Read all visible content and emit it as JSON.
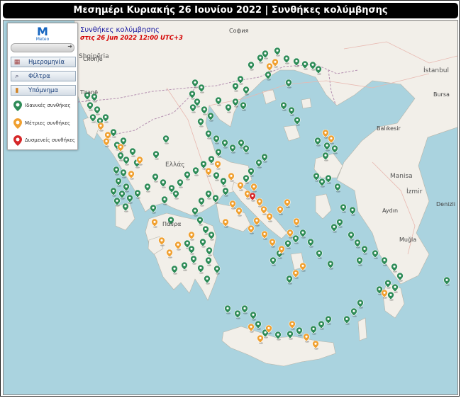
{
  "header": {
    "title": "Μεσημέρι Κυριακής 26 Ιουνίου 2022 | Συνθήκες κολύμβησης"
  },
  "map_title": {
    "title": "Συνθήκες κολύμβησης",
    "subtitle": "στις 26 Jun 2022 12:00 UTC+3"
  },
  "legend": {
    "logo_text": "Meteo",
    "buttons": [
      {
        "label": "Ημερομηνία",
        "icon": "calendar-icon"
      },
      {
        "label": "Φίλτρα",
        "icon": "filter-icon"
      },
      {
        "label": "Υπόμνημα",
        "icon": "legend-icon"
      }
    ],
    "items": [
      {
        "label": "Ιδανικές συνθήκες",
        "color": "#2e8b57"
      },
      {
        "label": "Μέτριες συνθήκες",
        "color": "#f0a030"
      },
      {
        "label": "Δυσμενείς συνθήκες",
        "color": "#d62728"
      }
    ]
  },
  "colors": {
    "ideal": "#2e8b57",
    "moderate": "#f0a030",
    "adverse": "#d62728",
    "sea": "#aad3df",
    "land": "#f2efe9"
  },
  "places": {
    "skopje": "Скопје",
    "sofia": "София",
    "istanbul": "İstanbul",
    "tirane": "Tiranë",
    "shqiperia": "Shqipëria",
    "ellas": "Ελλάς",
    "patra": "Πάτρα",
    "izmir": "İzmir",
    "balikesir": "Balıkesir",
    "manisa": "Manisa",
    "aydin": "Aydın",
    "mugla": "Muğla",
    "bursa": "Bursa",
    "denizli": "Denizli"
  },
  "markers": {
    "ideal": [
      [
        121,
        139
      ],
      [
        131,
        141
      ],
      [
        125,
        153
      ],
      [
        135,
        159
      ],
      [
        129,
        170
      ],
      [
        139,
        175
      ],
      [
        147,
        170
      ],
      [
        158,
        191
      ],
      [
        163,
        209
      ],
      [
        172,
        203
      ],
      [
        168,
        224
      ],
      [
        176,
        230
      ],
      [
        185,
        218
      ],
      [
        191,
        234
      ],
      [
        162,
        244
      ],
      [
        172,
        248
      ],
      [
        165,
        260
      ],
      [
        176,
        268
      ],
      [
        158,
        274
      ],
      [
        170,
        278
      ],
      [
        181,
        284
      ],
      [
        163,
        288
      ],
      [
        175,
        296
      ],
      [
        192,
        277
      ],
      [
        206,
        268
      ],
      [
        217,
        254
      ],
      [
        228,
        262
      ],
      [
        240,
        270
      ],
      [
        252,
        262
      ],
      [
        262,
        251
      ],
      [
        274,
        245
      ],
      [
        285,
        236
      ],
      [
        296,
        229
      ],
      [
        306,
        219
      ],
      [
        315,
        206
      ],
      [
        326,
        213
      ],
      [
        338,
        206
      ],
      [
        345,
        214
      ],
      [
        292,
        193
      ],
      [
        303,
        200
      ],
      [
        273,
        121
      ],
      [
        282,
        128
      ],
      [
        269,
        137
      ],
      [
        276,
        148
      ],
      [
        286,
        159
      ],
      [
        270,
        156
      ],
      [
        281,
        176
      ],
      [
        295,
        168
      ],
      [
        306,
        146
      ],
      [
        320,
        156
      ],
      [
        330,
        148
      ],
      [
        341,
        153
      ],
      [
        330,
        126
      ],
      [
        345,
        131
      ],
      [
        337,
        116
      ],
      [
        352,
        96
      ],
      [
        365,
        86
      ],
      [
        372,
        80
      ],
      [
        389,
        76
      ],
      [
        402,
        87
      ],
      [
        416,
        91
      ],
      [
        428,
        95
      ],
      [
        439,
        96
      ],
      [
        447,
        102
      ],
      [
        376,
        110
      ],
      [
        405,
        121
      ],
      [
        398,
        153
      ],
      [
        409,
        160
      ],
      [
        417,
        174
      ],
      [
        446,
        203
      ],
      [
        459,
        210
      ],
      [
        470,
        214
      ],
      [
        457,
        224
      ],
      [
        444,
        253
      ],
      [
        452,
        261
      ],
      [
        461,
        256
      ],
      [
        474,
        268
      ],
      [
        482,
        297
      ],
      [
        495,
        301
      ],
      [
        477,
        318
      ],
      [
        469,
        325
      ],
      [
        493,
        336
      ],
      [
        502,
        347
      ],
      [
        512,
        356
      ],
      [
        527,
        362
      ],
      [
        505,
        372
      ],
      [
        540,
        372
      ],
      [
        554,
        381
      ],
      [
        562,
        394
      ],
      [
        545,
        404
      ],
      [
        533,
        413
      ],
      [
        555,
        410
      ],
      [
        549,
        421
      ],
      [
        506,
        432
      ],
      [
        497,
        444
      ],
      [
        487,
        455
      ],
      [
        464,
        377
      ],
      [
        448,
        362
      ],
      [
        436,
        346
      ],
      [
        425,
        333
      ],
      [
        415,
        341
      ],
      [
        404,
        348
      ],
      [
        392,
        362
      ],
      [
        383,
        372
      ],
      [
        406,
        398
      ],
      [
        303,
        252
      ],
      [
        313,
        260
      ],
      [
        316,
        274
      ],
      [
        302,
        284
      ],
      [
        292,
        278
      ],
      [
        282,
        288
      ],
      [
        273,
        302
      ],
      [
        280,
        315
      ],
      [
        288,
        328
      ],
      [
        296,
        336
      ],
      [
        284,
        346
      ],
      [
        293,
        358
      ],
      [
        292,
        372
      ],
      [
        281,
        383
      ],
      [
        290,
        398
      ],
      [
        304,
        384
      ],
      [
        214,
        298
      ],
      [
        230,
        286
      ],
      [
        246,
        278
      ],
      [
        239,
        315
      ],
      [
        262,
        348
      ],
      [
        271,
        370
      ],
      [
        258,
        379
      ],
      [
        244,
        384
      ],
      [
        268,
        356
      ],
      [
        319,
        440
      ],
      [
        333,
        447
      ],
      [
        343,
        440
      ],
      [
        355,
        449
      ],
      [
        362,
        462
      ],
      [
        372,
        474
      ],
      [
        390,
        477
      ],
      [
        407,
        476
      ],
      [
        420,
        471
      ],
      [
        440,
        469
      ],
      [
        451,
        462
      ],
      [
        461,
        455
      ],
      [
        628,
        400
      ],
      [
        371,
        226
      ],
      [
        363,
        234
      ],
      [
        352,
        246
      ],
      [
        345,
        256
      ],
      [
        232,
        200
      ],
      [
        218,
        222
      ]
    ],
    "moderate": [
      [
        140,
        182
      ],
      [
        150,
        195
      ],
      [
        168,
        212
      ],
      [
        148,
        204
      ],
      [
        183,
        250
      ],
      [
        195,
        230
      ],
      [
        216,
        318
      ],
      [
        226,
        344
      ],
      [
        237,
        361
      ],
      [
        249,
        350
      ],
      [
        268,
        336
      ],
      [
        292,
        246
      ],
      [
        305,
        236
      ],
      [
        324,
        253
      ],
      [
        337,
        266
      ],
      [
        347,
        278
      ],
      [
        356,
        268
      ],
      [
        364,
        289
      ],
      [
        370,
        300
      ],
      [
        378,
        310
      ],
      [
        360,
        316
      ],
      [
        352,
        327
      ],
      [
        371,
        335
      ],
      [
        382,
        346
      ],
      [
        395,
        356
      ],
      [
        407,
        333
      ],
      [
        416,
        317
      ],
      [
        326,
        292
      ],
      [
        335,
        302
      ],
      [
        316,
        318
      ],
      [
        457,
        192
      ],
      [
        465,
        200
      ],
      [
        386,
        92
      ],
      [
        378,
        98
      ],
      [
        365,
        482
      ],
      [
        352,
        466
      ],
      [
        377,
        468
      ],
      [
        410,
        462
      ],
      [
        430,
        480
      ],
      [
        443,
        490
      ],
      [
        415,
        390
      ],
      [
        425,
        380
      ],
      [
        540,
        418
      ],
      [
        393,
        300
      ],
      [
        403,
        290
      ]
    ],
    "adverse": [
      [
        354,
        281
      ]
    ]
  }
}
